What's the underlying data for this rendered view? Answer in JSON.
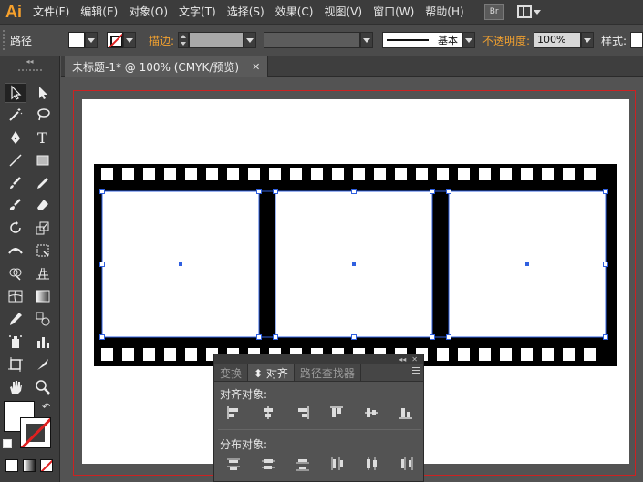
{
  "app": {
    "logo": "Ai"
  },
  "menu": {
    "items": [
      "文件(F)",
      "编辑(E)",
      "对象(O)",
      "文字(T)",
      "选择(S)",
      "效果(C)",
      "视图(V)",
      "窗口(W)",
      "帮助(H)"
    ],
    "bridge_label": "Br"
  },
  "control": {
    "path_label": "路径",
    "stroke_label": "描边:",
    "style_value": "基本",
    "opacity_label": "不透明度:",
    "opacity_value": "100%",
    "style_label": "样式:"
  },
  "document": {
    "tab_title": "未标题-1* @ 100% (CMYK/预览)",
    "close_glyph": "✕"
  },
  "align_panel": {
    "header_collapse": "◂◂",
    "header_close": "✕",
    "tabs": [
      {
        "label": "变换",
        "active": false
      },
      {
        "label": "⬍ 对齐",
        "active": true
      },
      {
        "label": "路径查找器",
        "active": false
      }
    ],
    "align_objects_label": "对齐对象:",
    "distribute_objects_label": "分布对象:",
    "align_icons": [
      "align-left-icon",
      "align-horizontal-center-icon",
      "align-right-icon",
      "align-top-icon",
      "align-vertical-center-icon",
      "align-bottom-icon"
    ],
    "distribute_icons": [
      "distribute-top-icon",
      "distribute-vertical-center-icon",
      "distribute-bottom-icon",
      "distribute-left-icon",
      "distribute-horizontal-center-icon",
      "distribute-right-icon"
    ]
  },
  "colors": {
    "accent_orange": "#f0a030",
    "artboard_bleed": "#cc2222",
    "selection_blue": "#3060e0",
    "film_black": "#000000"
  }
}
